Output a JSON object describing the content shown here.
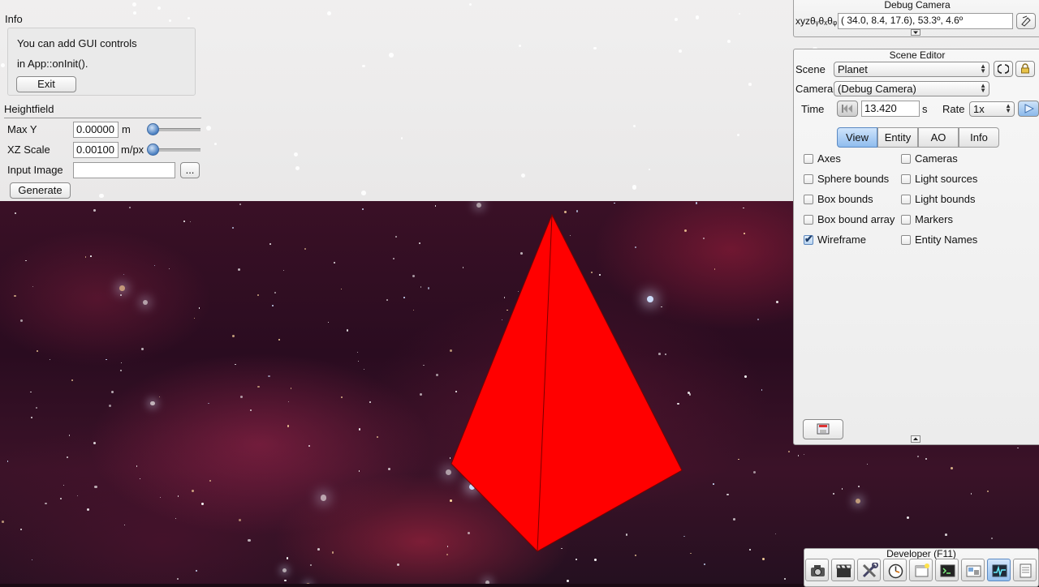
{
  "info_panel": {
    "title": "Info",
    "line1": "You can add GUI controls",
    "line2": "in App::onInit().",
    "exit_label": "Exit"
  },
  "heightfield": {
    "title": "Heightfield",
    "max_y_label": "Max Y",
    "max_y_value": "0.00000",
    "max_y_unit": "m",
    "xz_scale_label": "XZ Scale",
    "xz_scale_value": "0.00100",
    "xz_scale_unit": "m/px",
    "input_image_label": "Input Image",
    "input_image_value": "",
    "browse_label": "...",
    "generate_label": "Generate"
  },
  "debug_camera": {
    "title": "Debug Camera",
    "xyz_label": "xyzθᵧθₓθᵩ",
    "value": "( 34.0,   8.4,  17.6),  53.3º,   4.6º"
  },
  "scene_editor": {
    "title": "Scene Editor",
    "scene_label": "Scene",
    "scene_value": "Planet",
    "camera_label": "Camera",
    "camera_value": "(Debug Camera)",
    "time_label": "Time",
    "time_value": "13.420",
    "time_unit": "s",
    "rate_label": "Rate",
    "rate_value": "1x",
    "tabs": [
      "View",
      "Entity",
      "AO",
      "Info"
    ],
    "active_tab": "View",
    "checkboxes_left": [
      {
        "label": "Axes",
        "checked": false
      },
      {
        "label": "Sphere bounds",
        "checked": false
      },
      {
        "label": "Box bounds",
        "checked": false
      },
      {
        "label": "Box bound array",
        "checked": false
      },
      {
        "label": "Wireframe",
        "checked": true
      }
    ],
    "checkboxes_right": [
      {
        "label": "Cameras",
        "checked": false
      },
      {
        "label": "Light sources",
        "checked": false
      },
      {
        "label": "Light bounds",
        "checked": false
      },
      {
        "label": "Markers",
        "checked": false
      },
      {
        "label": "Entity Names",
        "checked": false
      }
    ]
  },
  "developer": {
    "title": "Developer (F11)",
    "tools": [
      "camera-icon",
      "film-clapper-icon",
      "tools-icon",
      "stopwatch-icon",
      "new-window-icon",
      "console-icon",
      "scene-layout-icon",
      "profiler-icon",
      "document-icon"
    ],
    "active_tool": "profiler-icon"
  },
  "scene": {
    "object_color": "#ff0000",
    "ui_accent": "#8fbcee"
  }
}
